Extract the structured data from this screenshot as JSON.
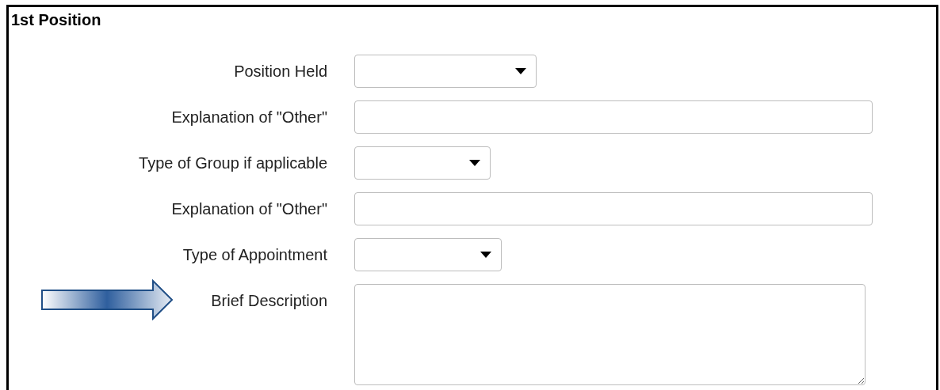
{
  "section": {
    "title": "1st Position"
  },
  "fields": [
    {
      "kind": "select",
      "label": "Position Held",
      "pointed": false
    },
    {
      "kind": "text",
      "label": "Explanation of \"Other\"",
      "pointed": false
    },
    {
      "kind": "select",
      "label": "Type of Group if applicable",
      "pointed": false
    },
    {
      "kind": "text",
      "label": "Explanation of \"Other\"",
      "pointed": false
    },
    {
      "kind": "select",
      "label": "Type of Appointment",
      "pointed": false
    },
    {
      "kind": "textarea",
      "label": "Brief Description",
      "pointed": true
    }
  ]
}
